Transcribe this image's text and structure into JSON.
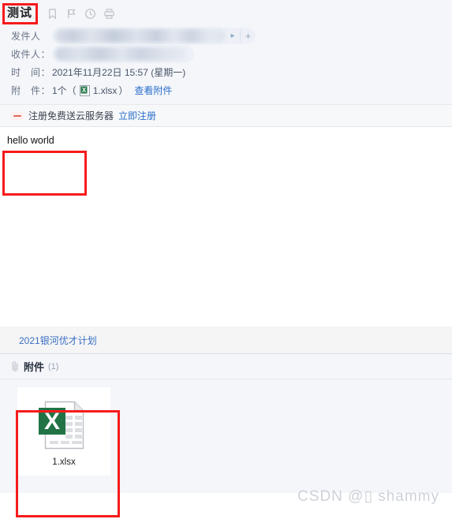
{
  "window": {
    "app": "mail-reader"
  },
  "header": {
    "subject": "测试",
    "icons": [
      {
        "name": "bookmark-icon",
        "label": "标记"
      },
      {
        "name": "flag-icon",
        "label": "旗标"
      },
      {
        "name": "clock-icon",
        "label": "定时"
      },
      {
        "name": "printer-icon",
        "label": "打印"
      }
    ],
    "fields": {
      "sender_label": "发件人",
      "sender_value": "",
      "sender_expand_icon": "chevron-right-icon",
      "sender_add_label": "+",
      "receiver_label": "收件人：",
      "receiver_value": "",
      "time_label": "时　间：",
      "time_value": "2021年11月22日 15:57 (星期一)",
      "attach_label": "附　件：",
      "attach_count_text": "1个（",
      "attach_file_name": "1.xlsx",
      "attach_close_paren": "）",
      "attach_view_link": "查看附件"
    }
  },
  "ad_banner": {
    "icon": "brand-logo-icon",
    "text": "注册免费送云服务器",
    "link": "立即注册"
  },
  "body": {
    "text": "hello world"
  },
  "promo": {
    "link": "2021银河优才计划"
  },
  "attachments_section": {
    "clip_icon": "paperclip-icon",
    "title": "附件",
    "count": "(1)",
    "files": [
      {
        "name": "1.xlsx",
        "icon": "excel-file-icon",
        "icon_letter": "X",
        "icon_color": "#217346"
      }
    ]
  },
  "annotations": [
    {
      "name": "subject-highlight",
      "color": "#f71b1b"
    },
    {
      "name": "body-highlight",
      "color": "#f71b1b"
    },
    {
      "name": "attachment-highlight",
      "color": "#f71b1b"
    }
  ],
  "watermark": {
    "text": "CSDN @▯ shammy"
  }
}
